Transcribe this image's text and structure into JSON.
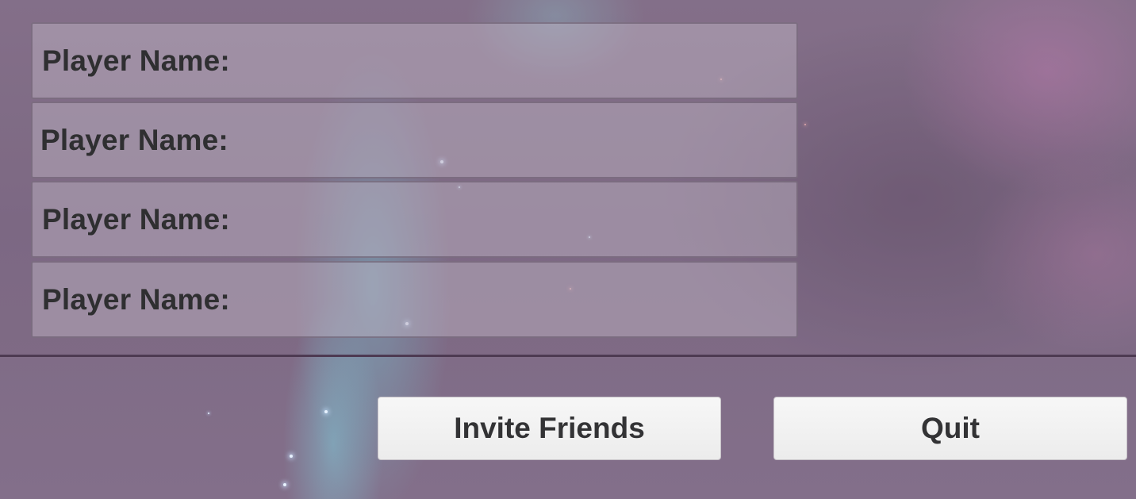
{
  "lobby": {
    "players": [
      {
        "label": "Player Name:"
      },
      {
        "label": "Player Name:"
      },
      {
        "label": "Player Name:"
      },
      {
        "label": "Player Name:"
      }
    ]
  },
  "actions": {
    "invite_label": "Invite Friends",
    "quit_label": "Quit"
  },
  "colors": {
    "background": "#836f8a",
    "row_fill": "#b9aebd",
    "button_fill": "#f2f2f2",
    "text": "#333335"
  }
}
